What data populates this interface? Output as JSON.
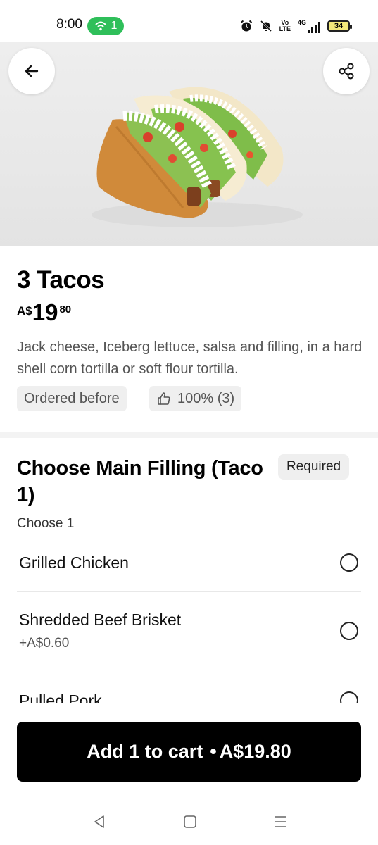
{
  "status_bar": {
    "time": "8:00",
    "hotspot_count": "1",
    "volte_top": "Vo",
    "volte_bottom": "LTE",
    "network": "4G",
    "battery": "34"
  },
  "product": {
    "title": "3 Tacos",
    "price_currency": "A$",
    "price_whole": "19",
    "price_cents": "80",
    "description": "Jack cheese, Iceberg lettuce, salsa and filling, in a hard shell corn tortilla or soft flour tortilla.",
    "ordered_before_label": "Ordered before",
    "rating_label": "100% (3)"
  },
  "section": {
    "title": "Choose Main Filling (Taco 1)",
    "required_label": "Required",
    "subtitle": "Choose 1",
    "options": [
      {
        "name": "Grilled Chicken",
        "price": ""
      },
      {
        "name": "Shredded Beef Brisket",
        "price": "+A$0.60"
      },
      {
        "name": "Pulled Pork",
        "price": ""
      }
    ]
  },
  "cart": {
    "label": "Add 1 to cart",
    "separator": "•",
    "total": "A$19.80"
  },
  "colors": {
    "accent_green": "#2fbf5a",
    "button_black": "#000000",
    "chip_bg": "#efefef"
  },
  "icons": [
    "back-arrow-icon",
    "share-icon",
    "thumbs-up-icon",
    "alarm-icon",
    "mute-icon",
    "signal-icon",
    "battery-icon",
    "hotspot-icon",
    "nav-back-icon",
    "nav-home-icon",
    "nav-menu-icon"
  ]
}
